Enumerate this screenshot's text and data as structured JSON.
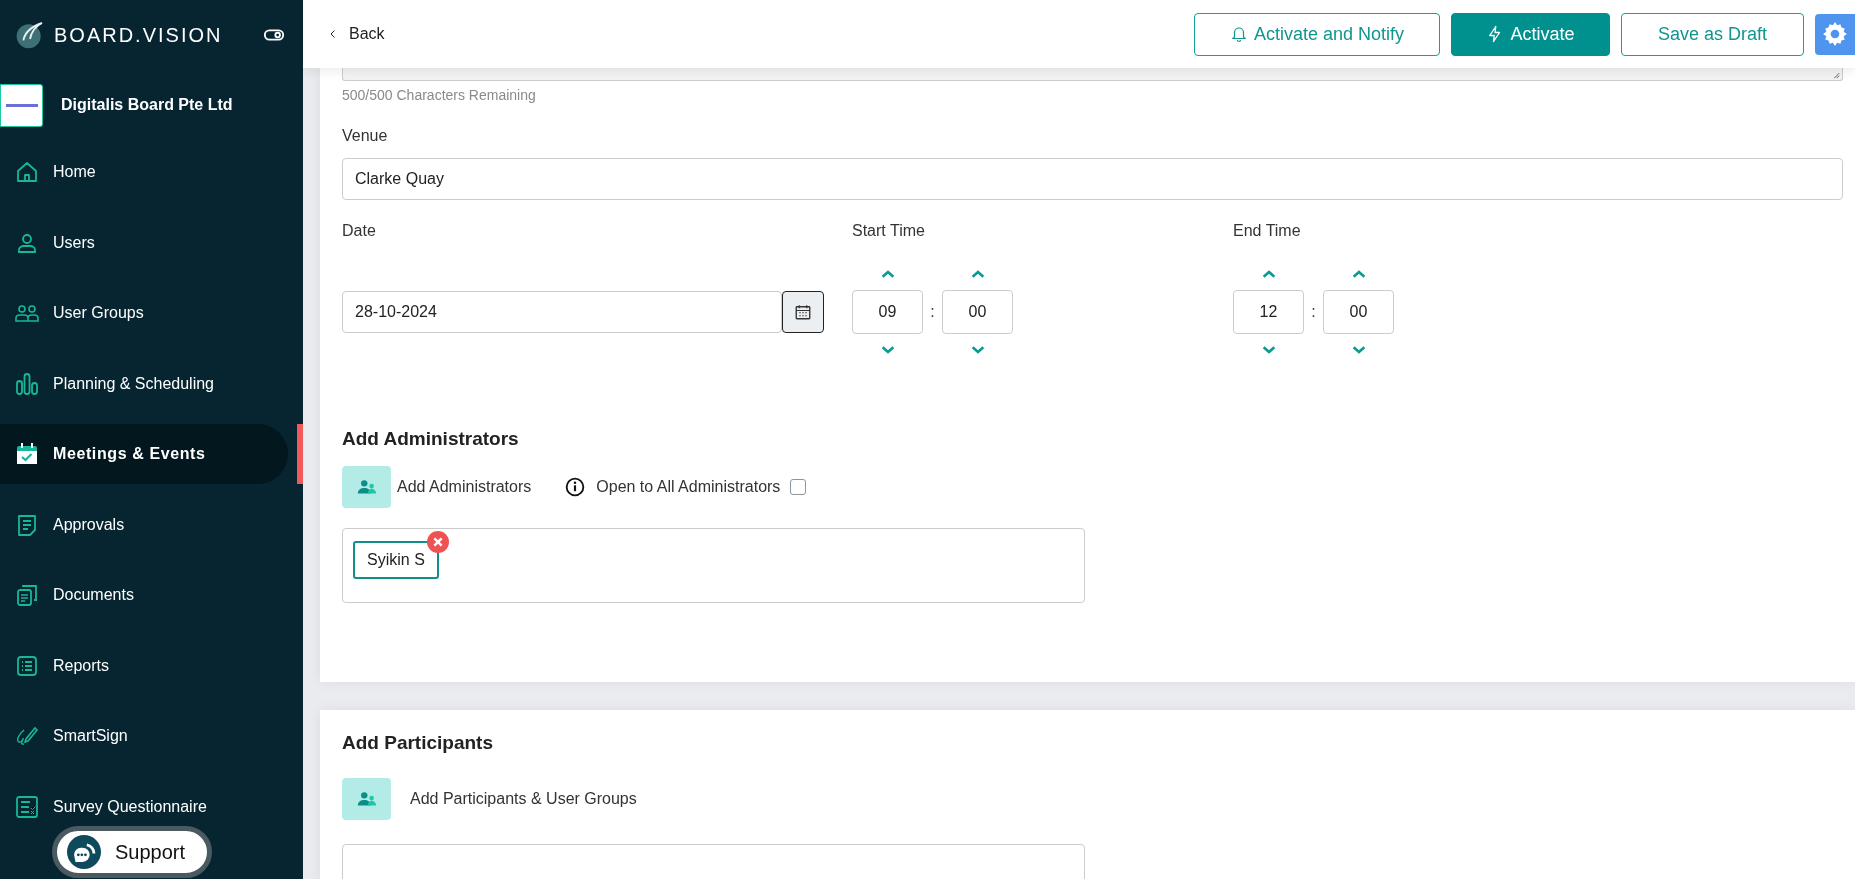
{
  "sidebar": {
    "brand": "BOARD.VISION",
    "organization": "Digitalis Board Pte Ltd",
    "items": [
      {
        "label": "Home",
        "kind": "home",
        "selected": false
      },
      {
        "label": "Users",
        "kind": "user",
        "selected": false
      },
      {
        "label": "User Groups",
        "kind": "group",
        "selected": false
      },
      {
        "label": "Planning & Scheduling",
        "kind": "bars",
        "selected": false
      },
      {
        "label": "Meetings & Events",
        "kind": "calendar",
        "selected": true
      },
      {
        "label": "Approvals",
        "kind": "note",
        "selected": false
      },
      {
        "label": "Documents",
        "kind": "docs",
        "selected": false
      },
      {
        "label": "Reports",
        "kind": "list",
        "selected": false
      },
      {
        "label": "SmartSign",
        "kind": "pen",
        "selected": false
      },
      {
        "label": "Survey Questionnaire",
        "kind": "survey",
        "selected": false
      }
    ]
  },
  "support": {
    "label": "Support"
  },
  "top_bar": {
    "back": "Back",
    "buttons": [
      {
        "label": "Activate and Notify",
        "kind": "notify"
      },
      {
        "label": "Activate",
        "kind": "activate"
      },
      {
        "label": "Save as Draft",
        "kind": "draft"
      }
    ]
  },
  "form": {
    "char_count": "500/500 Characters Remaining",
    "venue": {
      "label": "Venue",
      "value": "Clarke Quay"
    },
    "date": {
      "label": "Date",
      "value": "28-10-2024"
    },
    "times": [
      {
        "label": "Start Time",
        "hour": "09",
        "separator": ":",
        "minute": "00"
      },
      {
        "label": "End Time",
        "hour": "12",
        "separator": ":",
        "minute": "00"
      }
    ]
  },
  "administrators": {
    "heading": "Add Administrators",
    "add_label": "Add Administrators",
    "open_to_all": {
      "label": "Open to All Administrators",
      "checked": false
    },
    "chips": [
      "Syikin S"
    ]
  },
  "participants": {
    "heading": "Add Participants",
    "add_label": "Add Participants & User Groups"
  }
}
